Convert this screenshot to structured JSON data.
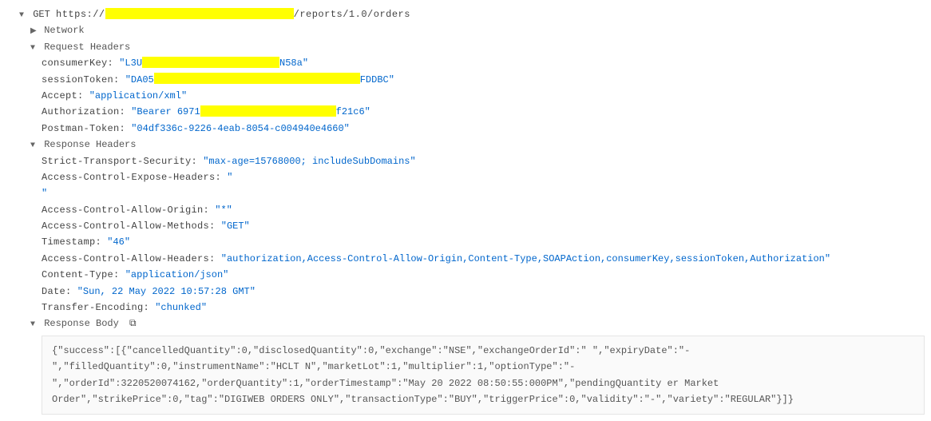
{
  "request": {
    "method": "GET",
    "url_prefix": "https://",
    "url_redacted_width": 236,
    "url_suffix": "/reports/1.0/orders"
  },
  "sections": {
    "network": "Network",
    "request_headers": "Request Headers",
    "response_headers": "Response Headers",
    "response_body": "Response Body"
  },
  "request_headers": {
    "consumer_key": {
      "label": "consumerKey:",
      "val_prefix": "\"L3U",
      "redact_width": 172,
      "val_suffix": "N58a\""
    },
    "session_token": {
      "label": "sessionToken:",
      "val_prefix": "\"DA05",
      "redact_width": 258,
      "val_suffix": "FDDBC\""
    },
    "accept": {
      "label": "Accept:",
      "value": "\"application/xml\""
    },
    "authorization": {
      "label": "Authorization:",
      "val_prefix": "\"Bearer 6971",
      "redact_width": 170,
      "val_suffix": "f21c6\""
    },
    "postman_token": {
      "label": "Postman-Token:",
      "value": "\"04df336c-9226-4eab-8054-c004940e4660\""
    }
  },
  "response_headers": {
    "sts": {
      "label": "Strict-Transport-Security:",
      "value": "\"max-age=15768000; includeSubDomains\""
    },
    "ace_headers": {
      "label": "Access-Control-Expose-Headers:",
      "value": "\""
    },
    "ace_tail": "\"",
    "ac_origin": {
      "label": "Access-Control-Allow-Origin:",
      "value": "\"*\""
    },
    "ac_methods": {
      "label": "Access-Control-Allow-Methods:",
      "value": "\"GET\""
    },
    "timestamp": {
      "label": "Timestamp:",
      "value": "\"46\""
    },
    "ac_headers": {
      "label": "Access-Control-Allow-Headers:",
      "value": "\"authorization,Access-Control-Allow-Origin,Content-Type,SOAPAction,consumerKey,sessionToken,Authorization\""
    },
    "content_type": {
      "label": "Content-Type:",
      "value": "\"application/json\""
    },
    "date": {
      "label": "Date:",
      "value": "\"Sun, 22 May 2022 10:57:28 GMT\""
    },
    "transfer_encoding": {
      "label": "Transfer-Encoding:",
      "value": "\"chunked\""
    }
  },
  "response_body": "{\"success\":[{\"cancelledQuantity\":0,\"disclosedQuantity\":0,\"exchange\":\"NSE\",\"exchangeOrderId\":\" \",\"expiryDate\":\"-\",\"filledQuantity\":0,\"instrumentName\":\"HCLT N\",\"marketLot\":1,\"multiplier\":1,\"optionType\":\"- \",\"orderId\":3220520074162,\"orderQuantity\":1,\"orderTimestamp\":\"May 20 2022 08:50:55:000PM\",\"pendingQuantity er Market Order\",\"strikePrice\":0,\"tag\":\"DIGIWEB ORDERS ONLY\",\"transactionType\":\"BUY\",\"triggerPrice\":0,\"validity\":\"-\",\"variety\":\"REGULAR\"}]}"
}
